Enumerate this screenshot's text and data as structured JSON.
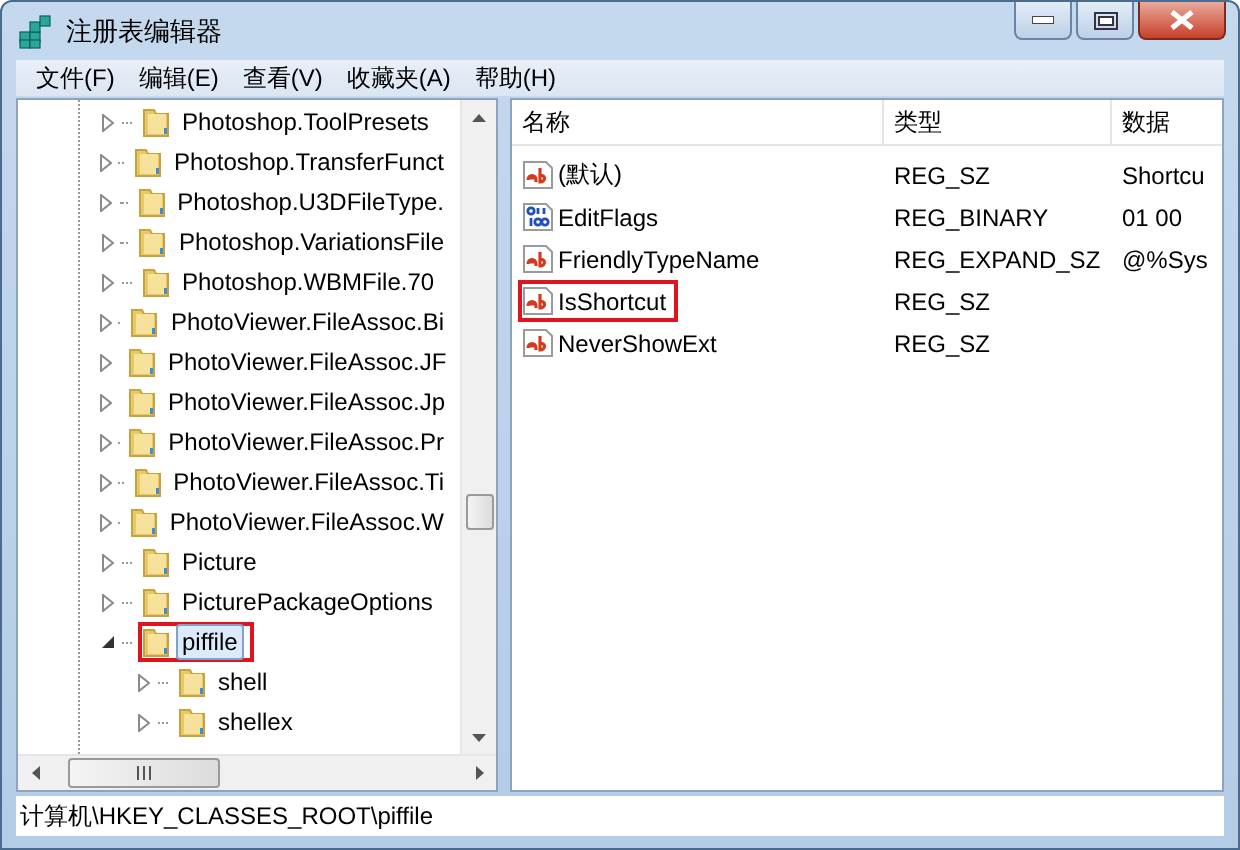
{
  "window": {
    "title": "注册表编辑器"
  },
  "menu": [
    "文件(F)",
    "编辑(E)",
    "查看(V)",
    "收藏夹(A)",
    "帮助(H)"
  ],
  "tree": {
    "items": [
      {
        "label": "Photoshop.ToolPresets",
        "expanded": false,
        "selected": false,
        "highlighted": false
      },
      {
        "label": "Photoshop.TransferFunct",
        "expanded": false,
        "selected": false,
        "highlighted": false
      },
      {
        "label": "Photoshop.U3DFileType.",
        "expanded": false,
        "selected": false,
        "highlighted": false
      },
      {
        "label": "Photoshop.VariationsFile",
        "expanded": false,
        "selected": false,
        "highlighted": false
      },
      {
        "label": "Photoshop.WBMFile.70",
        "expanded": false,
        "selected": false,
        "highlighted": false
      },
      {
        "label": "PhotoViewer.FileAssoc.Bi",
        "expanded": false,
        "selected": false,
        "highlighted": false
      },
      {
        "label": "PhotoViewer.FileAssoc.JF",
        "expanded": false,
        "selected": false,
        "highlighted": false
      },
      {
        "label": "PhotoViewer.FileAssoc.Jp",
        "expanded": false,
        "selected": false,
        "highlighted": false
      },
      {
        "label": "PhotoViewer.FileAssoc.Pr",
        "expanded": false,
        "selected": false,
        "highlighted": false
      },
      {
        "label": "PhotoViewer.FileAssoc.Ti",
        "expanded": false,
        "selected": false,
        "highlighted": false
      },
      {
        "label": "PhotoViewer.FileAssoc.W",
        "expanded": false,
        "selected": false,
        "highlighted": false
      },
      {
        "label": "Picture",
        "expanded": false,
        "selected": false,
        "highlighted": false
      },
      {
        "label": "PicturePackageOptions",
        "expanded": false,
        "selected": false,
        "highlighted": false
      },
      {
        "label": "piffile",
        "expanded": true,
        "selected": true,
        "highlighted": true,
        "children": [
          {
            "label": "shell",
            "expanded": false,
            "selected": false,
            "highlighted": false
          },
          {
            "label": "shellex",
            "expanded": false,
            "selected": false,
            "highlighted": false
          }
        ]
      }
    ]
  },
  "values": {
    "columns": [
      "名称",
      "类型",
      "数据"
    ],
    "rows": [
      {
        "kind": "string",
        "name": "(默认)",
        "type": "REG_SZ",
        "data": "Shortcu",
        "highlighted": false
      },
      {
        "kind": "binary",
        "name": "EditFlags",
        "type": "REG_BINARY",
        "data": "01 00",
        "highlighted": false
      },
      {
        "kind": "string",
        "name": "FriendlyTypeName",
        "type": "REG_EXPAND_SZ",
        "data": "@%Sys",
        "highlighted": false
      },
      {
        "kind": "string",
        "name": "IsShortcut",
        "type": "REG_SZ",
        "highlighted": true
      },
      {
        "kind": "string",
        "name": "NeverShowExt",
        "type": "REG_SZ",
        "highlighted": false
      }
    ]
  },
  "status_bar": "计算机\\HKEY_CLASSES_ROOT\\piffile"
}
